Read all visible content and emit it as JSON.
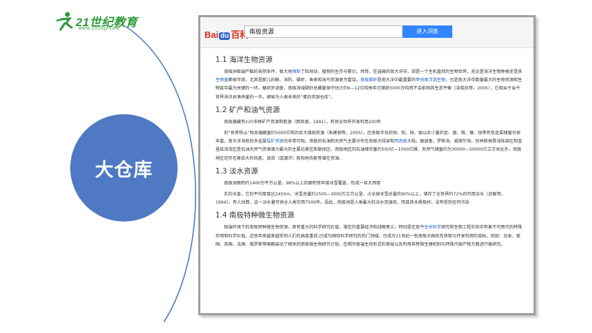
{
  "logo": {
    "brand": "21世纪教育",
    "url": "www.21cnjy.com"
  },
  "circle_label": "大仓库",
  "browser": {
    "baidu_left": "Bai",
    "baidu_mid": "du",
    "baidu_right": "百科",
    "search_value": "南极资源",
    "search_button": "进入词条"
  },
  "sections": [
    {
      "heading": "1.1 海洋生物资源"
    },
    {
      "heading": "1.2 矿产和油气资源"
    },
    {
      "heading": "1.3 淡水资源"
    },
    {
      "heading": "1.4 南极特种微生物资源"
    }
  ],
  "paragraphs": {
    "p1a": "　　南极洲极端严酷的自然条件，极大地",
    "p1_link1": "限制",
    "p1b": "了陆地动、植物的生存与繁衍。然而，在选输的南大洋中，却是一个生机盎然的生物世界，无论是海洋生物种类还是其",
    "p1_link2": "生物量",
    "p1c": "都很可观，尤其是那儿的鲸、海豹、磷虾、鱼类和海鸟资源更为富饶。",
    "p1_link3": "南极磷虾",
    "p1d": "是南大洋中最重要的",
    "p1_link4": "甲壳类浮游生物",
    "p1e": "，也是南大洋中数量最大的生物资源和生物链中最为关键的一环。据初步调查，南极海域磷虾总藏量保守估计约6—12亿吨每年可捕获5000万吨而不会影响其生态平衡（凌晓良等，2005），它相当于当今世界海洋总渔获量的一半，被喻为人类未来的“蛋白资源仓库”。",
    "p2": "　　南极蕴藏有220多种矿产资源和能源（颜其德，1991）。有供全世界开发利用200年",
    "p3a": "　　的“世界铁山”和总蕴藏量约5000亿吨的巨大煤田资源（朱建钢等，2005）。在南极半岛的铜、铅、锌、银以及少量的金、银、铬、镍、钴等有色金属储量也很丰富。南大洋海底的多金属",
    "p3_link1": "锰矿资源",
    "p3b": "也非常可观。南极的石油和天然气主要分布在南极大陆架和",
    "p3_link2": "西南极",
    "p3c": "大陆。据调查，罗斯海、威德尔海、别林斯高晋海陆架区和普里兹湾湾区是石油天然气资源潜力最大的主要远景区和勘探区。南极地区的石油储存量约500亿—1000亿桶，天然气储量约为30000—50000亿立方米此外，南极地区还存在着巨大的风能、波浪（或潮汐）能和地热能等潜在资源。",
    "p4": "　　南极洲面积约1400万平方公里，98%以上的面积常年被冰雪覆盖，形成一巨大西厚",
    "p5": "　　实的冰盖，它的平均厚度达2450m，冰雪总量约2500—3000万立方公里，占全球冰雪总量的90%以上，储存了全世界约72%的可用淡水（武衡等，1994）。有人估算，这一淡水量可供全人类饮用7500年。因此，南极洲是人类最大的淡水资源库，而且其水质极好，没有受到任何污染",
    "p6a": "　　极端环境下的南极特种微生物资源，具有重大的科学研究价值，潜在的重要经济和战略意义，特别是在现今",
    "p6_link1": "生命科学",
    "p6b": "研究和生物工程实验中有着不可替代的特殊作用和科学价值，近些年来越来越受到人们的高度重视,已成为国际科学研究的热门领域，也成为21世纪一些南极大国优先获取与开发利用的目标。例如：日本、美国、英国、法国、俄罗斯等国都启动了相关的南极微生物研究计划，在揭示极端生命形式的奥秘以及利用其特殊生理机制与特殊代谢产物方面进行着研究。"
  },
  "colors": {
    "circle": "#4f79c3",
    "arc": "#4f79c3",
    "logo_green": "#2f9a3a",
    "search_button": "#3385ff",
    "link": "#1f5fc4"
  }
}
